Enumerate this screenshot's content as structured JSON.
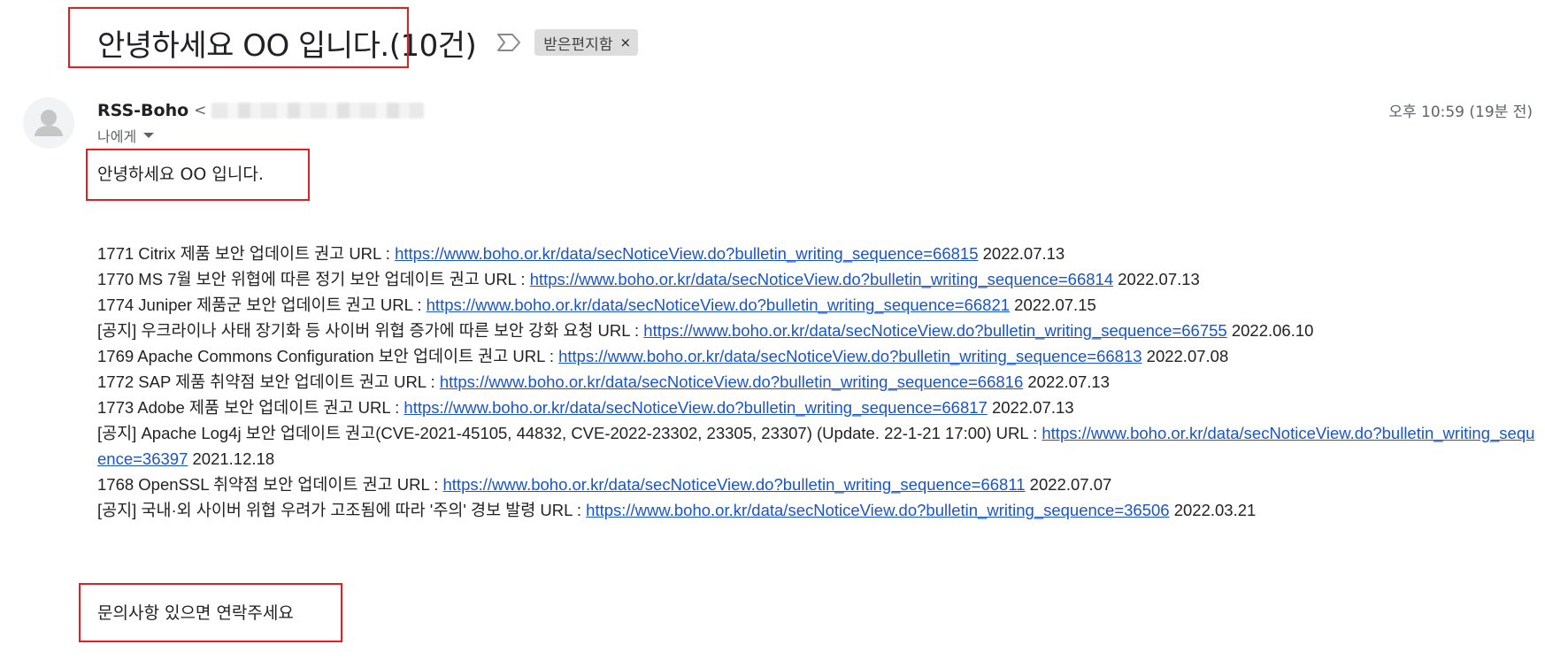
{
  "header": {
    "subject": "안녕하세요 OO 입니다.",
    "count": "(10건)",
    "important_icon": "important-marker-icon",
    "label": "받은편지함",
    "label_close": "×"
  },
  "sender": {
    "avatar_icon": "person-avatar-icon",
    "name": "RSS-Boho",
    "email_prefix": "<",
    "recipient": "나에게",
    "timestamp": "오후 10:59 (19분 전)"
  },
  "body": {
    "greeting": "안녕하세요 OO 입니다.",
    "items": [
      {
        "prefix": "1771 Citrix 제품 보안 업데이트 권고 URL : ",
        "url": "https://www.boho.or.kr/data/secNoticeView.do?bulletin_writing_sequence=66815",
        "date": " 2022.07.13"
      },
      {
        "prefix": "1770 MS 7월 보안 위협에 따른 정기 보안 업데이트 권고 URL : ",
        "url": "https://www.boho.or.kr/data/secNoticeView.do?bulletin_writing_sequence=66814",
        "date": " 2022.07.13"
      },
      {
        "prefix": "1774 Juniper 제품군 보안 업데이트 권고 URL : ",
        "url": "https://www.boho.or.kr/data/secNoticeView.do?bulletin_writing_sequence=66821",
        "date": " 2022.07.15"
      },
      {
        "prefix": "[공지] 우크라이나 사태 장기화 등 사이버 위협 증가에 따른 보안 강화 요청 URL : ",
        "url": "https://www.boho.or.kr/data/secNoticeView.do?bulletin_writing_sequence=66755",
        "date": " 2022.06.10"
      },
      {
        "prefix": "1769 Apache Commons Configuration 보안 업데이트 권고 URL : ",
        "url": "https://www.boho.or.kr/data/secNoticeView.do?bulletin_writing_sequence=66813",
        "date": " 2022.07.08"
      },
      {
        "prefix": "1772 SAP 제품 취약점 보안 업데이트 권고 URL : ",
        "url": "https://www.boho.or.kr/data/secNoticeView.do?bulletin_writing_sequence=66816",
        "date": " 2022.07.13"
      },
      {
        "prefix": "1773 Adobe 제품 보안 업데이트 권고 URL : ",
        "url": "https://www.boho.or.kr/data/secNoticeView.do?bulletin_writing_sequence=66817",
        "date": " 2022.07.13"
      },
      {
        "prefix": "[공지] Apache Log4j 보안 업데이트 권고(CVE-2021-45105, 44832, CVE-2022-23302, 23305, 23307) (Update. 22-1-21 17:00) URL : ",
        "url": "https://www.boho.or.kr/data/secNoticeView.do?bulletin_writing_sequence=36397",
        "date": " 2021.12.18"
      },
      {
        "prefix": "1768 OpenSSL 취약점 보안 업데이트 권고 URL : ",
        "url": "https://www.boho.or.kr/data/secNoticeView.do?bulletin_writing_sequence=66811",
        "date": " 2022.07.07"
      },
      {
        "prefix": "[공지] 국내·외 사이버 위협 우려가 고조됨에 따라 '주의' 경보 발령 URL : ",
        "url": "https://www.boho.or.kr/data/secNoticeView.do?bulletin_writing_sequence=36506",
        "date": " 2022.03.21"
      }
    ],
    "closing": "문의사항 있으면 연락주세요"
  },
  "colors": {
    "link": "#1a55c8",
    "annotation_box": "#e02020",
    "label_chip_bg": "#dddddd"
  }
}
